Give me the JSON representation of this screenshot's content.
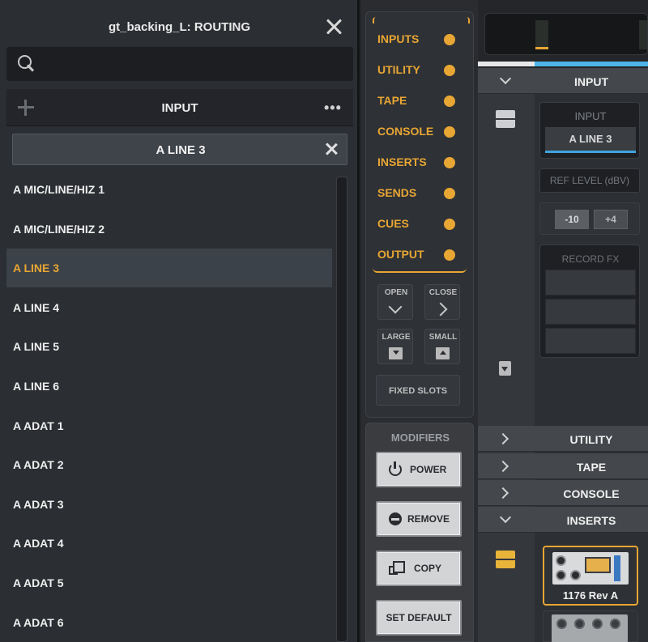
{
  "routing": {
    "title": "gt_backing_L: ROUTING",
    "search": {
      "placeholder": "",
      "value": ""
    },
    "section_title": "INPUT",
    "selected_value": "A LINE 3",
    "items": [
      {
        "label": "A MIC/LINE/HIZ 1",
        "selected": false
      },
      {
        "label": "A MIC/LINE/HIZ 2",
        "selected": false
      },
      {
        "label": "A LINE 3",
        "selected": true
      },
      {
        "label": "A LINE 4",
        "selected": false
      },
      {
        "label": "A LINE 5",
        "selected": false
      },
      {
        "label": "A LINE 6",
        "selected": false
      },
      {
        "label": "A ADAT 1",
        "selected": false
      },
      {
        "label": "A ADAT 2",
        "selected": false
      },
      {
        "label": "A ADAT 3",
        "selected": false
      },
      {
        "label": "A ADAT 4",
        "selected": false
      },
      {
        "label": "A ADAT 5",
        "selected": false
      },
      {
        "label": "A ADAT 6",
        "selected": false
      }
    ]
  },
  "categories": {
    "items": [
      "INPUTS",
      "UTILITY",
      "TAPE",
      "CONSOLE",
      "INSERTS",
      "SENDS",
      "CUES",
      "OUTPUT"
    ],
    "accent": "#e8a634",
    "open_label": "OPEN",
    "close_label": "CLOSE",
    "large_label": "LARGE",
    "small_label": "SMALL",
    "fixed_slots_label": "FIXED SLOTS"
  },
  "modifiers": {
    "title": "MODIFIERS",
    "power_label": "POWER",
    "remove_label": "REMOVE",
    "copy_label": "COPY",
    "set_default_label": "SET DEFAULT"
  },
  "strip": {
    "input_header": "INPUT",
    "input_block_title": "INPUT",
    "input_value": "A LINE 3",
    "ref_level_label": "REF LEVEL (dBV)",
    "ref_minus": "-10",
    "ref_plus": "+4",
    "record_fx_label": "RECORD FX",
    "utility_header": "UTILITY",
    "tape_header": "TAPE",
    "console_header": "CONSOLE",
    "inserts_header": "INSERTS",
    "plugin_name": "1176 Rev A",
    "meter_color": "#e8a634",
    "link_color": "#4fb3e8"
  }
}
